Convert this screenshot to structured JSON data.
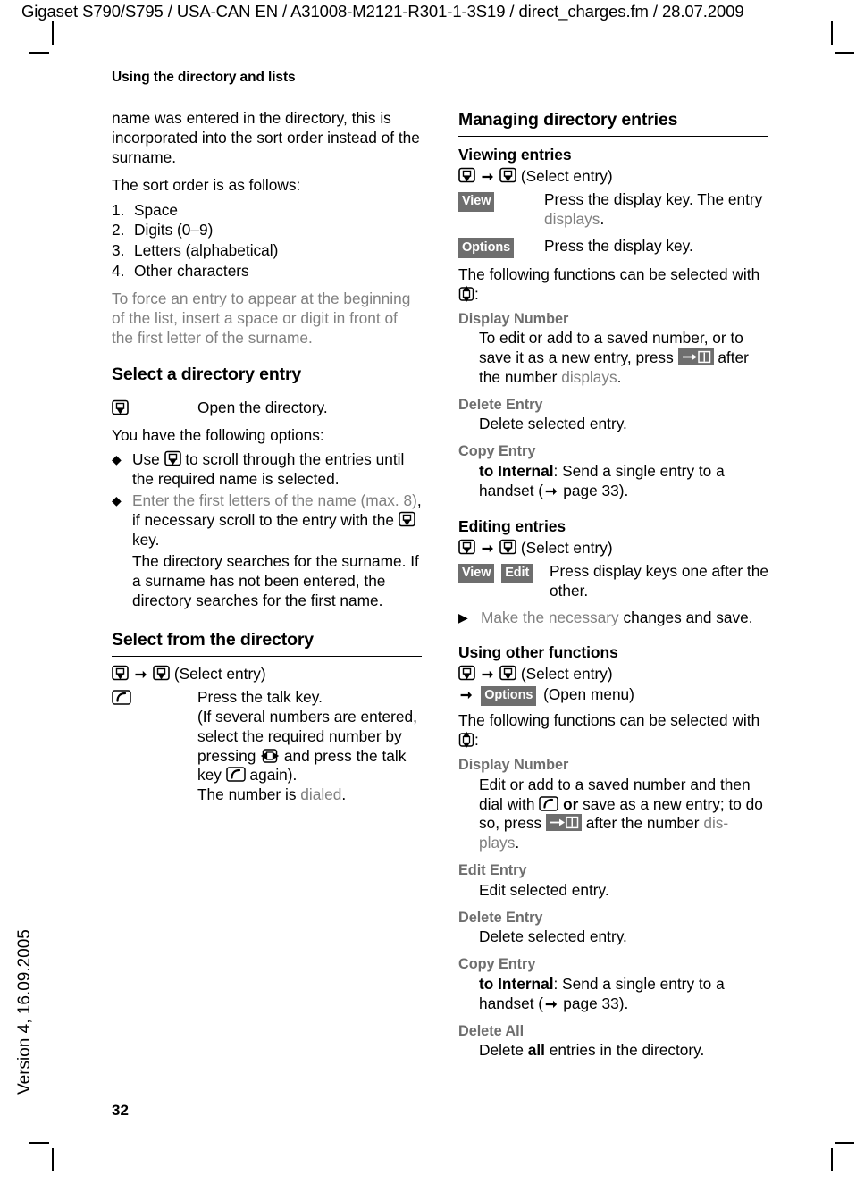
{
  "header": {
    "running_head": "Gigaset S790/S795 / USA-CAN EN / A31008-M2121-R301-1-3S19 / direct_charges.fm / 28.07.2009",
    "section_label": "Using the directory and lists",
    "version_footer": "Version 4, 16.09.2005",
    "page_number": "32"
  },
  "colors": {
    "display_key_background": "#6e6e6e",
    "display_key_text": "#ffffff",
    "gray_text": "#808080",
    "term_gray": "#6e6e6e",
    "body_text": "#000000"
  },
  "icons": {
    "scroll_down_key": "scroll-down-key-icon",
    "talk_key": "talk-key-icon",
    "left_right_key": "left-right-control-key-icon",
    "up_down_key": "up-down-control-key-icon",
    "to_directory_key": "copy-to-directory-key-icon",
    "arrow": "right-arrow-icon",
    "diamond_bullet": "diamond-bullet-icon",
    "triangle_bullet": "triangle-bullet-icon"
  },
  "left_column": {
    "para_1": "name was entered in the directory, this is incorporated into the sort order instead of the surname.",
    "para_2": "The sort order is as follows:",
    "sort_order": [
      {
        "num": "1.",
        "text": "Space"
      },
      {
        "num": "2.",
        "text": "Digits (0–9)"
      },
      {
        "num": "3.",
        "text": "Letters (alphabetical)"
      },
      {
        "num": "4.",
        "text": "Other characters"
      }
    ],
    "note": "To force an entry to appear at the beginning of the list, insert a space or digit in front of the first letter of the surname.",
    "section_select_entry": {
      "heading": "Select a directory entry",
      "open_directory_desc": "Open the directory.",
      "options_intro": "You have the following options:",
      "bullet_1_pre": "Use ",
      "bullet_1_post": " to scroll through the entries until the required name is selected.",
      "bullet_2_gray": "Enter the first letters of the name ",
      "bullet_2_gray_2": "(max. 8)",
      "bullet_2_black": ", if necessary scroll to the entry with the ",
      "bullet_2_end": " key.",
      "bullet_2_sub": "The directory searches for the surname. If a surname has not been entered, the directory searches for the first name."
    },
    "section_select_from": {
      "heading": "Select from the directory",
      "nav_select_entry": "(Select entry)",
      "talk_line_1": "Press the talk key.",
      "talk_line_2_a": "(If several numbers are entered, select the required number by pressing ",
      "talk_line_2_b": " and press the talk key ",
      "talk_line_2_c": " again).",
      "talk_line_3_a": "The number is ",
      "talk_line_3_b": "dialed",
      "talk_line_3_c": "."
    }
  },
  "right_column": {
    "section_managing": {
      "heading": "Managing directory entries",
      "viewing": {
        "sub_heading": "Viewing entries",
        "nav_select_entry": "(Select entry)",
        "view_key": "View",
        "view_desc_a": "Press the display key. The entry ",
        "view_desc_b": "displays",
        "view_desc_c": ".",
        "options_key": "Options",
        "options_desc": "Press the display key.",
        "functions_intro_a": "The following functions can be selected with ",
        "functions_intro_b": ":",
        "items": [
          {
            "term": "Display Number",
            "def_a": "To edit or add to a saved number, or to save it as a new entry, press ",
            "def_b": " after the number ",
            "def_gray": "displays",
            "def_c": "."
          },
          {
            "term": "Delete Entry",
            "def_a": "Delete selected entry."
          },
          {
            "term": "Copy Entry",
            "def_bold": "to Internal",
            "def_a": ": Send a single entry to a handset (",
            "def_page": " page 33).",
            "def_c": ""
          }
        ]
      },
      "editing": {
        "sub_heading": "Editing entries",
        "nav_select_entry": "(Select entry)",
        "view_key": "View",
        "edit_key": "Edit",
        "keys_desc": "Press display keys one after the other.",
        "step_gray": "Make the necessary ",
        "step_black": "changes and save."
      },
      "other": {
        "sub_heading": "Using other functions",
        "nav_select_entry": "(Select entry)",
        "options_key": "Options",
        "open_menu": "(Open menu)",
        "functions_intro_a": "The following functions can be selected with ",
        "functions_intro_b": ":",
        "items": [
          {
            "term": "Display Number",
            "def_a": "Edit or add to a saved number and then dial with ",
            "def_or": "or",
            "def_b": " save as a new entry; to do so, press ",
            "def_c": " after the number ",
            "def_gray": "dis-plays",
            "def_d": "."
          },
          {
            "term": "Edit Entry",
            "def_a": "Edit selected entry."
          },
          {
            "term": "Delete Entry",
            "def_a": "Delete selected entry."
          },
          {
            "term": "Copy Entry",
            "def_bold": "to Internal",
            "def_a": ": Send a single entry to a handset (",
            "def_page": " page 33)."
          },
          {
            "term": "Delete All",
            "def_a": "Delete ",
            "def_bold2": "all",
            "def_b": " entries in the directory."
          }
        ]
      }
    }
  }
}
